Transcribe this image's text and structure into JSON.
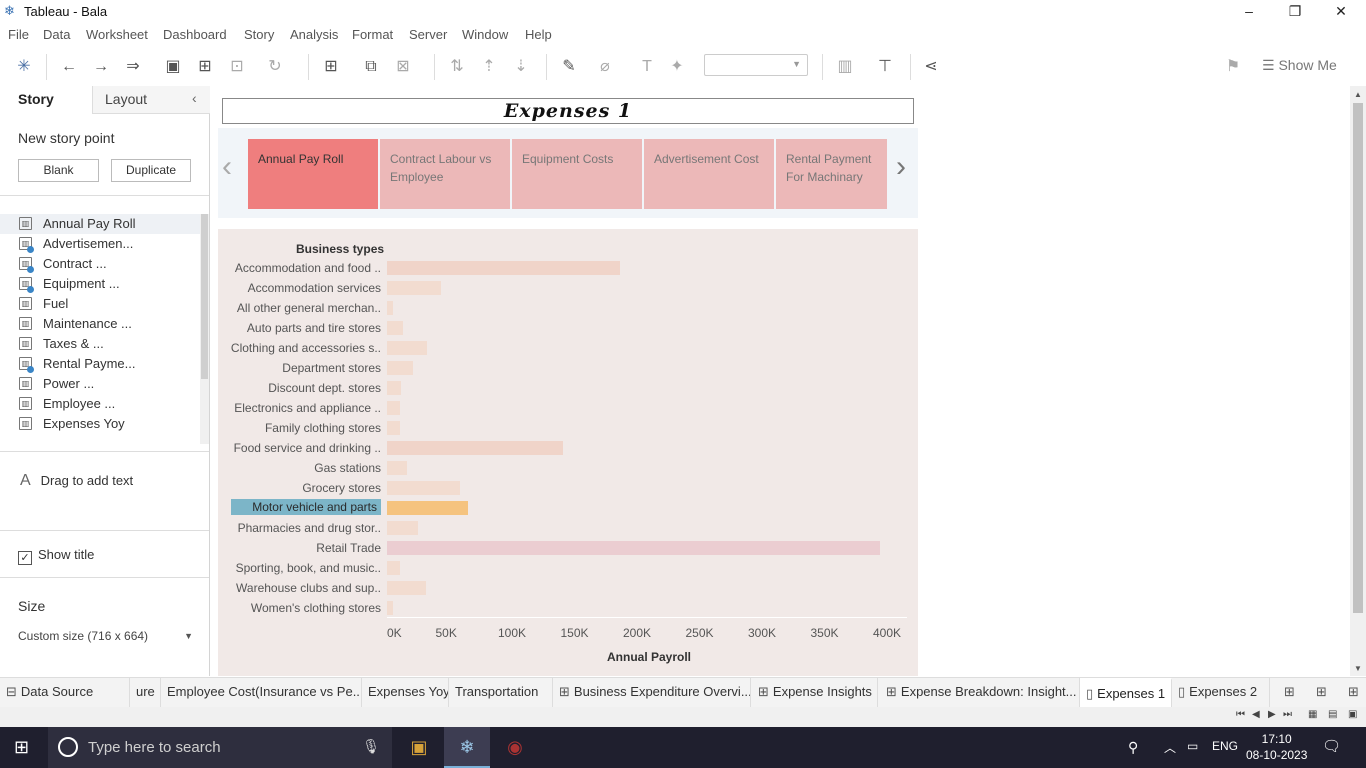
{
  "window": {
    "title": "Tableau - Bala",
    "icon": "tableau-logo-icon"
  },
  "menu": [
    "File",
    "Data",
    "Worksheet",
    "Dashboard",
    "Story",
    "Analysis",
    "Format",
    "Server",
    "Window",
    "Help"
  ],
  "toolbar": {
    "show_me": "Show Me"
  },
  "left_panel": {
    "tabs": {
      "story": "Story",
      "layout": "Layout"
    },
    "new_story_point": "New story point",
    "blank": "Blank",
    "duplicate": "Duplicate",
    "sheets": [
      {
        "label": "Annual Pay Roll",
        "used": false
      },
      {
        "label": "Advertisemen...",
        "used": true
      },
      {
        "label": "Contract ...",
        "used": true
      },
      {
        "label": "Equipment ...",
        "used": true
      },
      {
        "label": "Fuel",
        "used": false
      },
      {
        "label": "Maintenance ...",
        "used": false
      },
      {
        "label": "Taxes & ...",
        "used": false
      },
      {
        "label": "Rental Payme...",
        "used": true
      },
      {
        "label": "Power ...",
        "used": false
      },
      {
        "label": "Employee ...",
        "used": false
      },
      {
        "label": "Expenses Yoy",
        "used": false
      }
    ],
    "drag_text": "Drag to add text",
    "show_title": "Show title",
    "size_heading": "Size",
    "size_value": "Custom size (716 x 664)"
  },
  "story": {
    "title": "Expenses 1",
    "points": [
      {
        "label": "Annual Pay Roll",
        "active": true
      },
      {
        "label": "Contract Labour vs Employee",
        "active": false
      },
      {
        "label": "Equipment Costs",
        "active": false
      },
      {
        "label": "Advertisement Cost",
        "active": false
      },
      {
        "label": "Rental Payment For Machinary",
        "active": false
      }
    ]
  },
  "chart_data": {
    "type": "bar",
    "orientation": "horizontal",
    "row_header": "Business types",
    "xlabel": "Annual Payroll",
    "xlim": [
      0,
      400000
    ],
    "xticks": [
      "0K",
      "50K",
      "100K",
      "150K",
      "200K",
      "250K",
      "300K",
      "350K",
      "400K"
    ],
    "highlighted": "Motor vehicle and parts",
    "categories": [
      "Accommodation and food ..",
      "Accommodation services",
      "All other general merchan..",
      "Auto parts and tire stores",
      "Clothing and accessories s..",
      "Department stores",
      "Discount dept. stores",
      "Electronics and appliance ..",
      "Family clothing stores",
      "Food service and drinking ..",
      "Gas stations",
      "Grocery stores",
      "Motor vehicle and parts",
      "Pharmacies and drug stor..",
      "Retail Trade",
      "Sporting, book, and  music..",
      "Warehouse clubs and sup..",
      "Women's clothing stores"
    ],
    "values": [
      186000,
      43000,
      5000,
      13000,
      32000,
      21000,
      11000,
      10000,
      10000,
      141000,
      16000,
      58000,
      65000,
      25000,
      394000,
      10000,
      31000,
      5000
    ],
    "colors": {
      "default": "#f2dcd0",
      "highlight": "#f5c37f",
      "retail_trade": "#ebcdd1",
      "accommodation_food": "#f0d4c9",
      "food_service": "#f0d4c9"
    }
  },
  "sheet_tabs": [
    {
      "label": "Data Source",
      "icon": "data-source-icon"
    },
    {
      "label": "ure",
      "icon": ""
    },
    {
      "label": "Employee Cost(Insurance vs Pe...",
      "icon": ""
    },
    {
      "label": "Expenses Yoy",
      "icon": ""
    },
    {
      "label": "Transportation",
      "icon": ""
    },
    {
      "label": "Business Expenditure Overvi...",
      "icon": "dashboard-icon"
    },
    {
      "label": "Expense Insights",
      "icon": "dashboard-icon"
    },
    {
      "label": "Expense Breakdown: Insight...",
      "icon": "dashboard-icon"
    },
    {
      "label": "Expenses 1",
      "icon": "story-icon"
    },
    {
      "label": "Expenses 2",
      "icon": "story-icon"
    }
  ],
  "taskbar": {
    "search_placeholder": "Type here to search",
    "lang": "ENG",
    "time": "17:10",
    "date": "08-10-2023",
    "notifications": "1"
  }
}
